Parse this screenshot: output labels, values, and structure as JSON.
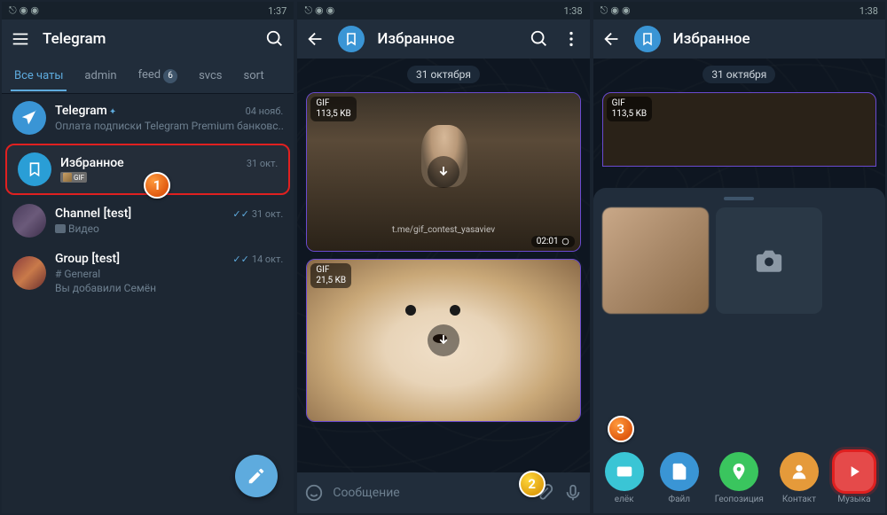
{
  "statusbar": {
    "time1": "1:37",
    "time2": "1:38",
    "time3": "1:38"
  },
  "app_title": "Telegram",
  "tabs": [
    {
      "label": "Все чаты",
      "active": true
    },
    {
      "label": "admin"
    },
    {
      "label": "feed",
      "badge": "6"
    },
    {
      "label": "svcs"
    },
    {
      "label": "sort"
    }
  ],
  "chats": [
    {
      "name": "Telegram",
      "msg": "Оплата подписки Telegram Premium банковс...",
      "time": "04 нояб.",
      "verified": true
    },
    {
      "name": "Избранное",
      "msg": "GIF",
      "time": "31 окт."
    },
    {
      "name": "Channel [test]",
      "msg": "Видео",
      "time": "31 окт.",
      "checks": true
    },
    {
      "name": "Group [test]",
      "sub": "# General",
      "msg": "Вы добавили Семён",
      "time": "14 окт.",
      "checks": true
    }
  ],
  "saved_title": "Избранное",
  "date_label": "31 октября",
  "gifs": [
    {
      "label": "GIF",
      "size": "113,5 KB",
      "duration": "02:01",
      "watermark": "t.me/gif_contest_yasaviev"
    },
    {
      "label": "GIF",
      "size": "21,5 KB"
    }
  ],
  "input_placeholder": "Сообщение",
  "attach": {
    "items": [
      {
        "label": "елёк",
        "color": "c-cyan",
        "icon": "wallet"
      },
      {
        "label": "Файл",
        "color": "c-blue",
        "icon": "file"
      },
      {
        "label": "Геопозиция",
        "color": "c-green",
        "icon": "pin"
      },
      {
        "label": "Контакт",
        "color": "c-orange",
        "icon": "person"
      },
      {
        "label": "Музыка",
        "color": "c-red",
        "icon": "play",
        "highlight": true
      }
    ]
  },
  "markers": {
    "m1": "1",
    "m2": "2",
    "m3": "3"
  }
}
